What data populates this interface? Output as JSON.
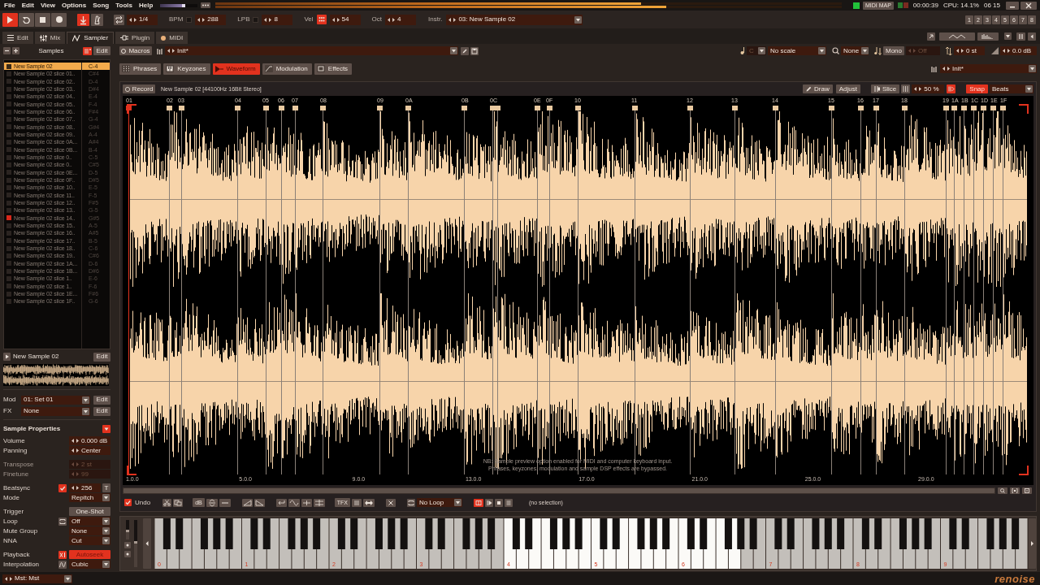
{
  "menu_bar": {
    "menus": [
      "File",
      "Edit",
      "View",
      "Options",
      "Song",
      "Tools",
      "Help"
    ],
    "master_volume": {
      "level": 0.66
    },
    "peak_meters": [
      {
        "level": 0.68
      },
      {
        "level": 0.72
      }
    ],
    "midi_map_button": "MIDI MAP",
    "playback_time": "00:00:39",
    "cpu_usage": "CPU: 14.1%",
    "clock": "06 15"
  },
  "transport": {
    "buttons": [
      {
        "kind": "play",
        "on": true
      },
      {
        "kind": "loop",
        "on": false
      },
      {
        "kind": "stop",
        "on": false
      },
      {
        "kind": "record",
        "on": false
      }
    ],
    "follow": {
      "on": true
    },
    "metronome": {
      "on": false
    },
    "block_loop": {
      "on": false,
      "value": "1/4"
    },
    "fields": [
      {
        "label": "BPM",
        "value": "288",
        "switch": {
          "on": false
        }
      },
      {
        "label": "LPB",
        "value": "8",
        "switch": {
          "on": false
        }
      },
      {
        "label": "Vel",
        "value": "54",
        "switch": {
          "on": true
        }
      },
      {
        "label": "Oct",
        "value": "4"
      }
    ],
    "instrument": {
      "label": "Instr.",
      "value": "03: New Sample 02"
    },
    "track_buttons": [
      "1",
      "2",
      "3",
      "4",
      "5",
      "6",
      "7",
      "8"
    ]
  },
  "view_tabs": [
    {
      "label": "Edit",
      "kind": "edit",
      "selected": false
    },
    {
      "label": "Mix",
      "kind": "mix",
      "selected": false
    },
    {
      "label": "Sampler",
      "kind": "sampler",
      "selected": true
    },
    {
      "label": "Plugin",
      "kind": "plugin",
      "selected": false
    },
    {
      "label": "MIDI",
      "kind": "midi",
      "selected": false
    }
  ],
  "samples_panel": {
    "title": "Samples",
    "edit_button": "Edit",
    "list_toggle": {
      "on": true
    },
    "samples": [
      {
        "name": "New Sample 02",
        "note": "C-4",
        "selected": true,
        "playing": false
      },
      {
        "name": "New Sample 02 slice 01..",
        "note": "C#4",
        "selected": false,
        "playing": false
      },
      {
        "name": "New Sample 02 slice 02..",
        "note": "D-4",
        "selected": false,
        "playing": false
      },
      {
        "name": "New Sample 02 slice 03..",
        "note": "D#4",
        "selected": false,
        "playing": false
      },
      {
        "name": "New Sample 02 slice 04..",
        "note": "E-4",
        "selected": false,
        "playing": false
      },
      {
        "name": "New Sample 02 slice 05..",
        "note": "F-4",
        "selected": false,
        "playing": false
      },
      {
        "name": "New Sample 02 slice 06..",
        "note": "F#4",
        "selected": false,
        "playing": false
      },
      {
        "name": "New Sample 02 slice 07..",
        "note": "G-4",
        "selected": false,
        "playing": false
      },
      {
        "name": "New Sample 02 slice 08..",
        "note": "G#4",
        "selected": false,
        "playing": false
      },
      {
        "name": "New Sample 02 slice 09..",
        "note": "A-4",
        "selected": false,
        "playing": false
      },
      {
        "name": "New Sample 02 slice 0A...",
        "note": "A#4",
        "selected": false,
        "playing": false
      },
      {
        "name": "New Sample 02 slice 0B...",
        "note": "B-4",
        "selected": false,
        "playing": false
      },
      {
        "name": "New Sample 02 slice 0..",
        "note": "C-5",
        "selected": false,
        "playing": false
      },
      {
        "name": "New Sample 02 slice 0..",
        "note": "C#5",
        "selected": false,
        "playing": false
      },
      {
        "name": "New Sample 02 slice 0E...",
        "note": "D-5",
        "selected": false,
        "playing": false
      },
      {
        "name": "New Sample 02 slice 0F..",
        "note": "D#5",
        "selected": false,
        "playing": false
      },
      {
        "name": "New Sample 02 slice 10..",
        "note": "E-5",
        "selected": false,
        "playing": false
      },
      {
        "name": "New Sample 02 slice 11..",
        "note": "F-5",
        "selected": false,
        "playing": false
      },
      {
        "name": "New Sample 02 slice 12..",
        "note": "F#5",
        "selected": false,
        "playing": false
      },
      {
        "name": "New Sample 02 slice 13..",
        "note": "G-5",
        "selected": false,
        "playing": false
      },
      {
        "name": "New Sample 02 slice 14..",
        "note": "G#5",
        "selected": false,
        "playing": true
      },
      {
        "name": "New Sample 02 slice 15..",
        "note": "A-5",
        "selected": false,
        "playing": false
      },
      {
        "name": "New Sample 02 slice 16..",
        "note": "A#5",
        "selected": false,
        "playing": false
      },
      {
        "name": "New Sample 02 slice 17..",
        "note": "B-5",
        "selected": false,
        "playing": false
      },
      {
        "name": "New Sample 02 slice 18..",
        "note": "C-6",
        "selected": false,
        "playing": false
      },
      {
        "name": "New Sample 02 slice 19..",
        "note": "C#6",
        "selected": false,
        "playing": false
      },
      {
        "name": "New Sample 02 slice 1A...",
        "note": "D-6",
        "selected": false,
        "playing": false
      },
      {
        "name": "New Sample 02 slice 1B...",
        "note": "D#6",
        "selected": false,
        "playing": false
      },
      {
        "name": "New Sample 02 slice 1..",
        "note": "E-6",
        "selected": false,
        "playing": false
      },
      {
        "name": "New Sample 02 slice 1..",
        "note": "F-6",
        "selected": false,
        "playing": false
      },
      {
        "name": "New Sample 02 slice 1E...",
        "note": "F#6",
        "selected": false,
        "playing": false
      },
      {
        "name": "New Sample 02 slice 1F..",
        "note": "G-6",
        "selected": false,
        "playing": false
      }
    ],
    "preview": {
      "name": "New Sample 02",
      "edit_button": "Edit"
    },
    "routing": [
      {
        "label": "Mod",
        "value": "01: Set 01",
        "button": "Edit"
      },
      {
        "label": "FX",
        "value": "None",
        "button": "Edit"
      }
    ],
    "properties": {
      "title": "Sample Properties",
      "expanded": true,
      "groups": [
        [
          {
            "kind": "stepper",
            "label": "Volume",
            "value": "0.000 dB",
            "disabled": false
          },
          {
            "kind": "stepper",
            "label": "Panning",
            "value": "Center",
            "disabled": false
          }
        ],
        [
          {
            "kind": "stepper",
            "label": "Transpose",
            "value": "2 st",
            "disabled": true
          },
          {
            "kind": "stepper",
            "label": "Finetune",
            "value": "99",
            "disabled": true
          }
        ],
        [
          {
            "kind": "beatsync",
            "label": "Beatsync",
            "checked": true,
            "value": "256",
            "button": "T"
          },
          {
            "kind": "dropdown",
            "label": "Mode",
            "value": "Repitch"
          }
        ],
        [
          {
            "kind": "button",
            "label": "Trigger",
            "value": "One-Shot"
          },
          {
            "kind": "loop",
            "label": "Loop",
            "value": "Off",
            "toggle": {
              "on": false
            }
          },
          {
            "kind": "dropdown",
            "label": "Mute Group",
            "value": "None"
          },
          {
            "kind": "dropdown",
            "label": "NNA",
            "value": "Cut"
          }
        ],
        [
          {
            "kind": "toggle",
            "label": "Playback",
            "value": "Autoseek",
            "on": true
          },
          {
            "kind": "interpolation",
            "label": "Interpolation",
            "value": "Cubic",
            "toggle": {
              "on": false
            }
          }
        ]
      ]
    }
  },
  "instrument_bar": {
    "macros_button": "Macros",
    "preset": "Init*",
    "scale_key": {
      "value": "C",
      "disabled": true
    },
    "scale": "No scale",
    "quantize": "None",
    "mono_button": {
      "label": "Mono",
      "on": false
    },
    "glide": {
      "value": "Off",
      "disabled": true
    },
    "transpose": "0 st",
    "volume": "0.0 dB"
  },
  "editor_tabs": [
    {
      "label": "Phrases",
      "kind": "phrases",
      "selected": false
    },
    {
      "label": "Keyzones",
      "kind": "keyzones",
      "selected": false
    },
    {
      "label": "Waveform",
      "kind": "waveform",
      "selected": true
    },
    {
      "label": "Modulation",
      "kind": "modulation",
      "selected": false
    },
    {
      "label": "Effects",
      "kind": "effects",
      "selected": false
    }
  ],
  "phrase_preset": "Init*",
  "waveform_editor": {
    "record_button": "Record",
    "sample_info": "New Sample 02 [44100Hz 16Bit Stereo]",
    "draw_button": "Draw",
    "adjust_button": "Adjust",
    "slice_button": "Slice",
    "zoom": "50 %",
    "lock": {
      "on": true
    },
    "snap": {
      "label": "Snap",
      "on": true
    },
    "snap_unit": "Beats",
    "slice_labels": [
      "01",
      "02",
      "03",
      "04",
      "05",
      "06",
      "07",
      "08",
      "09",
      "0A",
      "0B",
      "0C",
      "0E",
      "0F",
      "10",
      "11",
      "12",
      "13",
      "14",
      "15",
      "16",
      "17",
      "18",
      "19",
      "1A",
      "1B",
      "1C",
      "1D",
      "1E",
      "1F"
    ],
    "notice": [
      "NB: Sample preview option enabled for MIDI and computer keyboard input.",
      "Phrases, keyzones, modulation and sample DSP effects are bypassed."
    ],
    "ruler": [
      "1.0.0",
      "5.0.0",
      "9.0.0",
      "13.0.0",
      "17.0.0",
      "21.0.0",
      "25.0.0",
      "29.0.0"
    ]
  },
  "sample_toolbar": {
    "undo": {
      "label": "Undo",
      "checked": true
    },
    "level_button": "dB",
    "tfx_button": "TFX",
    "loop_mode": "No Loop",
    "preview": {
      "on": true
    },
    "selection": "(no selection)"
  },
  "keyboard": {
    "wheels": [
      {
        "level": 0.5
      },
      {
        "level": 0.55
      }
    ],
    "octaves": [
      {
        "label": "0",
        "mapped": [
          false,
          false,
          false,
          false,
          false,
          false,
          false
        ]
      },
      {
        "label": "1",
        "mapped": [
          false,
          false,
          false,
          false,
          false,
          false,
          false
        ]
      },
      {
        "label": "2",
        "mapped": [
          false,
          false,
          false,
          false,
          false,
          false,
          false
        ]
      },
      {
        "label": "3",
        "mapped": [
          false,
          false,
          false,
          false,
          false,
          false,
          false
        ]
      },
      {
        "label": "4",
        "mapped": [
          true,
          true,
          true,
          true,
          true,
          true,
          true
        ]
      },
      {
        "label": "5",
        "mapped": [
          true,
          true,
          true,
          true,
          true,
          true,
          true
        ]
      },
      {
        "label": "6",
        "mapped": [
          true,
          true,
          true,
          true,
          true,
          false,
          false
        ]
      },
      {
        "label": "7",
        "mapped": [
          false,
          false,
          false,
          false,
          false,
          false,
          false
        ]
      },
      {
        "label": "8",
        "mapped": [
          false,
          false,
          false,
          false,
          false,
          false,
          false
        ]
      },
      {
        "label": "9",
        "mapped": [
          false,
          false,
          false,
          false,
          false,
          false,
          false
        ]
      }
    ]
  },
  "status_bar": {
    "master_route": "Mst: Mst",
    "logo": "renoise"
  }
}
